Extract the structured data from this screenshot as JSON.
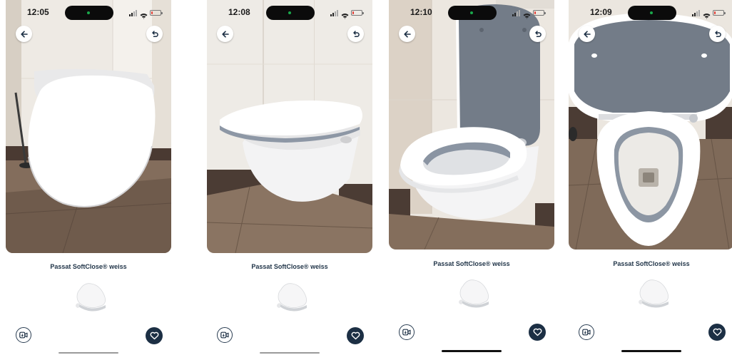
{
  "screens": [
    {
      "status": {
        "time": "12:05",
        "battery_level": 0.15
      },
      "product": {
        "title": "Passat SoftClose® weiss"
      },
      "view_state": "lid closed, front view"
    },
    {
      "status": {
        "time": "12:08",
        "battery_level": 0.15
      },
      "product": {
        "title": "Passat SoftClose® weiss"
      },
      "view_state": "lid closed, side view"
    },
    {
      "status": {
        "time": "12:10",
        "battery_level": 0.15
      },
      "product": {
        "title": "Passat SoftClose® weiss"
      },
      "view_state": "lid open, side view"
    },
    {
      "status": {
        "time": "12:09",
        "battery_level": 0.15
      },
      "product": {
        "title": "Passat SoftClose® weiss"
      },
      "view_state": "lid open, top view"
    }
  ],
  "icons": {
    "back": "arrow-left-icon",
    "reset": "undo-icon",
    "camera": "video-camera-icon",
    "favorite": "heart-icon"
  },
  "colors": {
    "accent_dark": "#1c2f44",
    "title_text": "#1f3347",
    "lid_underside": "#727b86",
    "ceramic": "#ffffff",
    "wall_tile": "#ece8e2",
    "floor_tile": "#7f6a5a",
    "battery_low": "#e2372f"
  }
}
